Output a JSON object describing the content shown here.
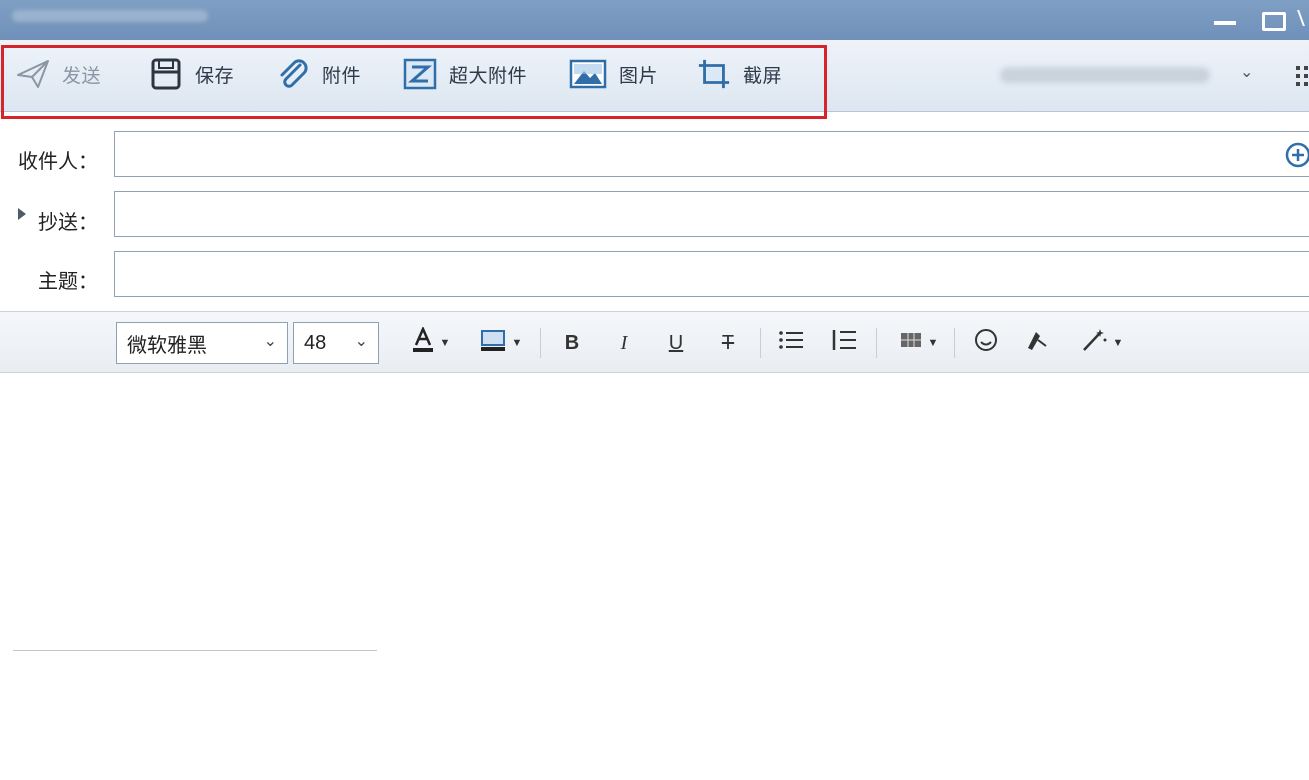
{
  "toolbar": {
    "send_label": "发送",
    "save_label": "保存",
    "attach_label": "附件",
    "big_attach_label": "超大附件",
    "picture_label": "图片",
    "screenshot_label": "截屏"
  },
  "fields": {
    "to_label": "收件人：",
    "cc_label": "抄送：",
    "subject_label": "主题："
  },
  "format": {
    "font_value": "微软雅黑",
    "size_value": "48",
    "bold": "B",
    "italic": "I",
    "underline": "U",
    "strike": "T"
  },
  "icons": {
    "send": "send-icon",
    "save": "save-icon",
    "attach": "paperclip-icon",
    "big_attach": "big-attachment-icon",
    "picture": "picture-icon",
    "screenshot": "screenshot-icon",
    "add_contact": "add-contact-icon",
    "apps": "apps-grid-icon"
  },
  "colors": {
    "title_bar": "#7396bf",
    "highlight": "#d7242a",
    "toolbar_icon": "#2f6ea8"
  }
}
